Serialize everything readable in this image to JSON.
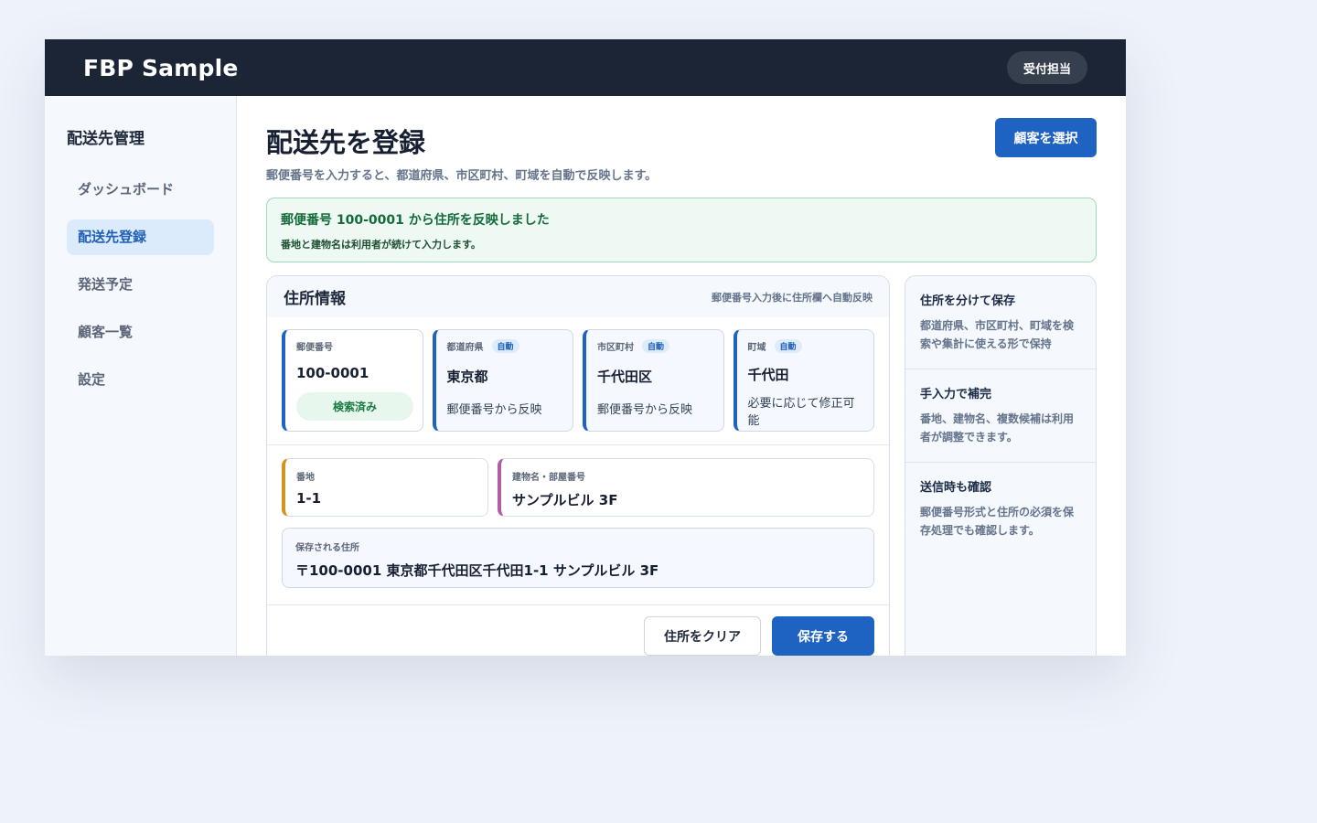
{
  "app": {
    "brand": "FBP Sample",
    "role_badge": "受付担当"
  },
  "sidebar": {
    "title": "配送先管理",
    "items": [
      {
        "label": "ダッシュボード",
        "active": false
      },
      {
        "label": "配送先登録",
        "active": true
      },
      {
        "label": "発送予定",
        "active": false
      },
      {
        "label": "顧客一覧",
        "active": false
      },
      {
        "label": "設定",
        "active": false
      }
    ]
  },
  "header": {
    "title": "配送先を登録",
    "subtitle": "郵便番号を入力すると、都道府県、市区町村、町域を自動で反映します。",
    "select_customer_label": "顧客を選択"
  },
  "alert": {
    "title": "郵便番号 100-0001 から住所を反映しました",
    "body": "番地と建物名は利用者が続けて入力します。"
  },
  "form": {
    "title": "住所情報",
    "note": "郵便番号入力後に住所欄へ自動反映",
    "auto_tag": "自動",
    "zip": {
      "label": "郵便番号",
      "value": "100-0001",
      "status": "検索済み"
    },
    "prefecture": {
      "label": "都道府県",
      "value": "東京都",
      "note": "郵便番号から反映"
    },
    "city": {
      "label": "市区町村",
      "value": "千代田区",
      "note": "郵便番号から反映"
    },
    "town": {
      "label": "町域",
      "value": "千代田",
      "note": "必要に応じて修正可能"
    },
    "banchi": {
      "label": "番地",
      "value": "1-1"
    },
    "building": {
      "label": "建物名・部屋番号",
      "value": "サンプルビル 3F"
    },
    "saved": {
      "label": "保存される住所",
      "value": "〒100-0001 東京都千代田区千代田1-1 サンプルビル 3F"
    },
    "clear_label": "住所をクリア",
    "save_label": "保存する"
  },
  "info": {
    "items": [
      {
        "title": "住所を分けて保存",
        "body": "都道府県、市区町村、町域を検索や集計に使える形で保持"
      },
      {
        "title": "手入力で補完",
        "body": "番地、建物名、複数候補は利用者が調整できます。"
      },
      {
        "title": "送信時も確認",
        "body": "郵便番号形式と住所の必須を保存処理でも確認します。"
      }
    ]
  },
  "colors": {
    "topbar": "#1c2536",
    "primary": "#1f63c2",
    "success_text": "#146b3a",
    "banchi_accent": "#d4921e",
    "building_accent": "#b35ca5"
  }
}
